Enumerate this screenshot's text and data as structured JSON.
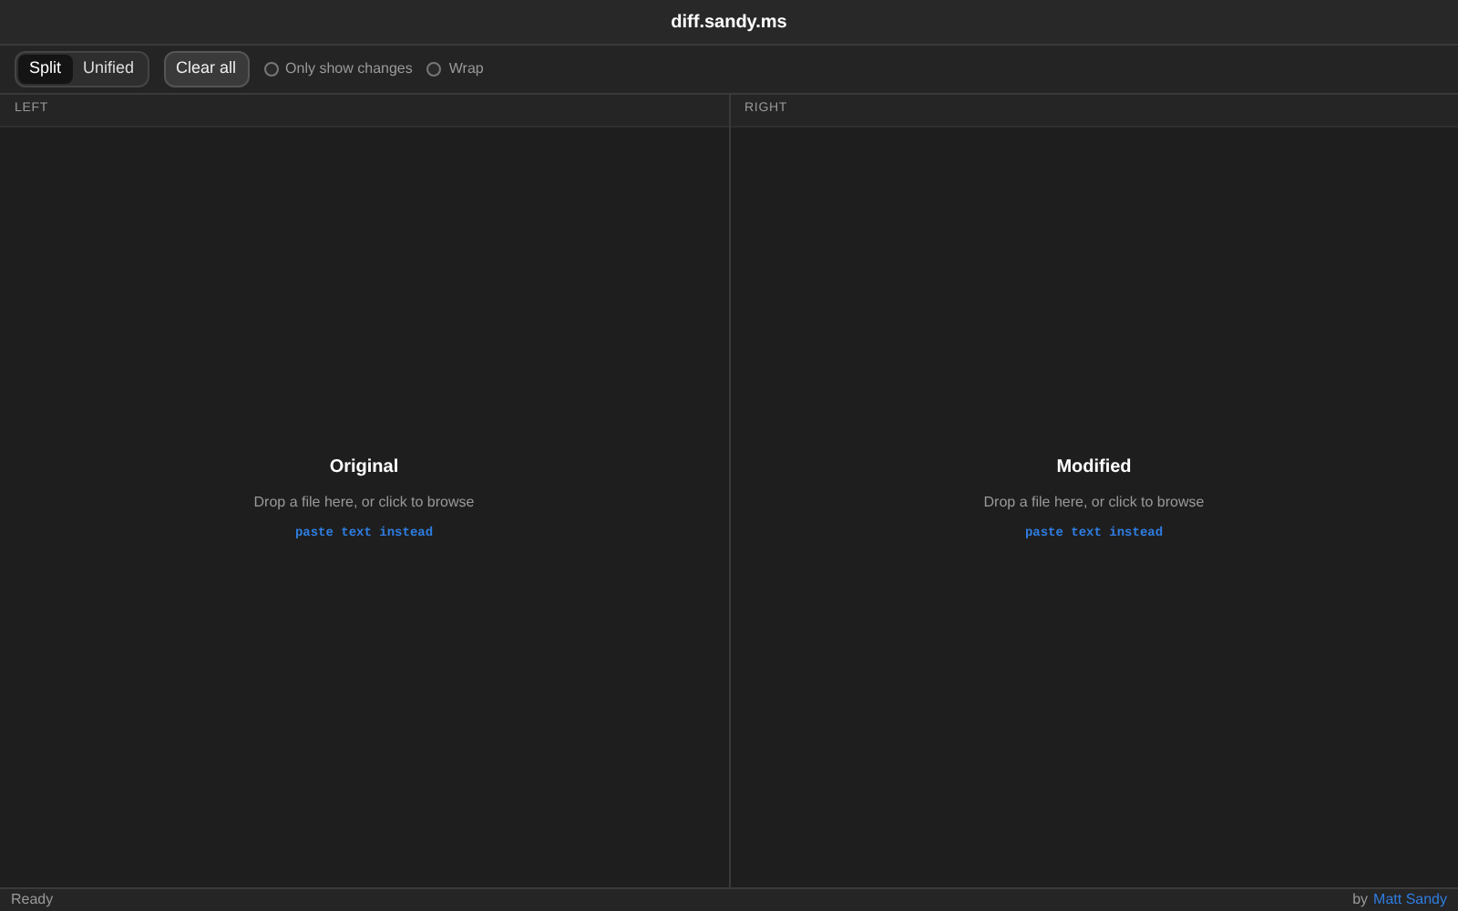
{
  "window": {
    "title": "diff.sandy.ms"
  },
  "toolbar": {
    "view_modes": [
      {
        "label": "Split",
        "selected": true
      },
      {
        "label": "Unified",
        "selected": false
      }
    ],
    "clear_button": "Clear all",
    "options": [
      {
        "label": "Only show changes",
        "checked": false
      },
      {
        "label": "Wrap",
        "checked": false
      }
    ]
  },
  "panes": [
    {
      "header": "LEFT",
      "title": "Original",
      "hint": "Drop a file here, or click to browse",
      "link": "paste text instead"
    },
    {
      "header": "RIGHT",
      "title": "Modified",
      "hint": "Drop a file here, or click to browse",
      "link": "paste text instead"
    }
  ],
  "status_bar": {
    "status": "Ready",
    "credit_prefix": "by",
    "credit_link": "Matt Sandy"
  }
}
